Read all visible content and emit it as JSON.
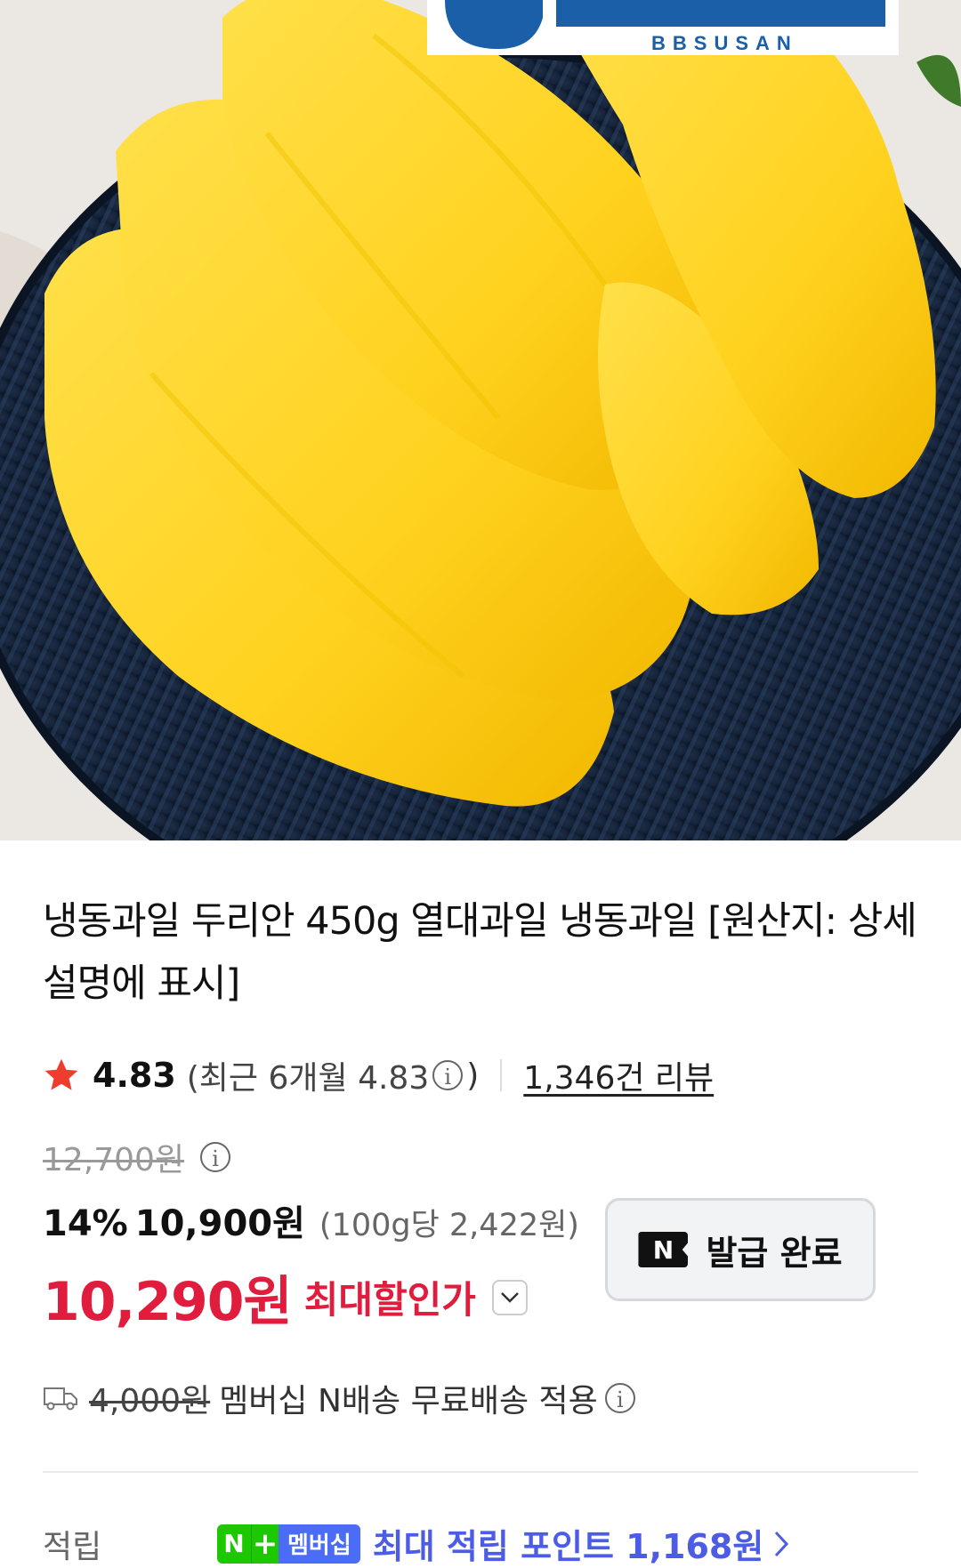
{
  "hero": {
    "brand_logo_text": "BBSUSAN",
    "image_description_icon": "durian-photo"
  },
  "product": {
    "title": "냉동과일 두리안 450g 열대과일 냉동과일 [원산지: 상세설명에 표시]"
  },
  "rating": {
    "score": "4.83",
    "recent_open": "(최근 6개월 4.83",
    "recent_close": ")",
    "reviews": "1,346건 리뷰",
    "star_color": "#f03c2e"
  },
  "price": {
    "original": "12,700원",
    "discount_rate": "14%",
    "discounted": "10,900원",
    "unit_price": "(100g당 2,422원)",
    "max_discount": "10,290원",
    "max_discount_label": "최대할인가",
    "accent_color": "#e11d3d"
  },
  "coupon": {
    "badge": "N",
    "label": "발급 완료"
  },
  "delivery": {
    "old_fee": "4,000원",
    "text": "멤버십 N배송 무료배송 적용"
  },
  "points": {
    "label": "적립",
    "badge_n": "N",
    "badge_plus": "+",
    "badge_membership": "멤버십",
    "text": "최대 적립 포인트 1,168원",
    "color": "#4d5ce6"
  }
}
